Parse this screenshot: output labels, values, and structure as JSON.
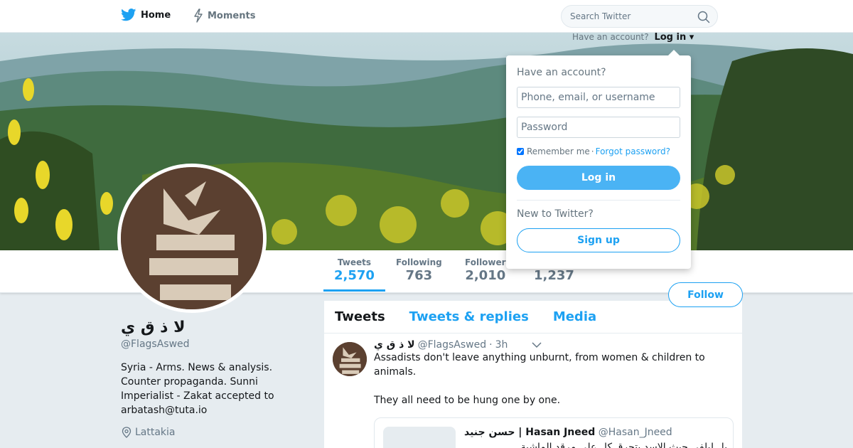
{
  "nav": {
    "home_label": "Home",
    "moments_label": "Moments",
    "search_placeholder": "Search Twitter"
  },
  "header_login": {
    "prompt": "Have an account?",
    "login_label": "Log in"
  },
  "login_dropdown": {
    "title": "Have an account?",
    "username_placeholder": "Phone, email, or username",
    "password_placeholder": "Password",
    "remember_label": "Remember me",
    "separator": "·",
    "forgot_label": "Forgot password?",
    "login_button": "Log in",
    "new_prompt": "New to Twitter?",
    "signup_button": "Sign up"
  },
  "stats": [
    {
      "label": "Tweets",
      "value": "2,570"
    },
    {
      "label": "Following",
      "value": "763"
    },
    {
      "label": "Follower",
      "value": "2,010"
    },
    {
      "label": "",
      "value": "1,237"
    }
  ],
  "follow_button": "Follow",
  "profile": {
    "name": "لا ذ ق ي",
    "handle": "@FlagsAswed",
    "bio": "Syria - Arms. News & analysis. Counter propaganda. Sunni Imperialist - Zakat accepted to arbatash@tuta.io",
    "location": "Lattakia"
  },
  "timeline": {
    "tabs": [
      "Tweets",
      "Tweets & replies",
      "Media"
    ],
    "tweet": {
      "name": "لا ذ ق ي",
      "handle": "@FlagsAswed",
      "dot": "·",
      "time": "3h",
      "text": "Assadists don't leave anything unburnt, from women & children to animals.\n\nThey all need to be hung one by one.",
      "quote": {
        "name": "حسن جنيد | Hasan Jneed",
        "handle": "@Hasan_Jneed",
        "text": "بل ليلفي حيث الاسد يتحرق كل على مرقد الماشية"
      }
    }
  },
  "colors": {
    "accent": "#1da1f2",
    "login_button": "#4ab3f4",
    "background": "#e6ecf0"
  }
}
